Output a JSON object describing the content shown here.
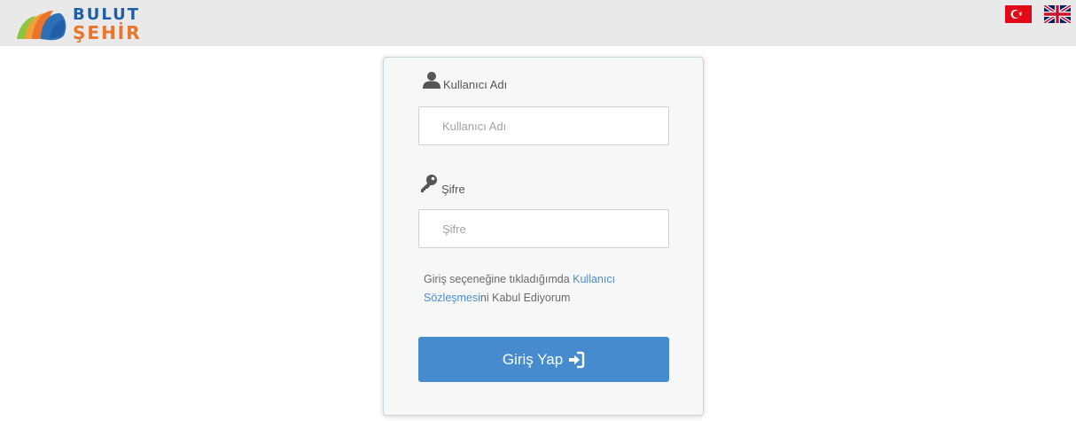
{
  "header": {
    "logo": {
      "line1": "BULUT",
      "line2": "ŞEHİR"
    },
    "languages": [
      {
        "code": "tr",
        "icon": "turkey-flag-icon"
      },
      {
        "code": "en",
        "icon": "uk-flag-icon"
      }
    ]
  },
  "login": {
    "username": {
      "label": "Kullanıcı Adı",
      "placeholder": "Kullanıcı Adı",
      "value": "",
      "icon": "user-icon"
    },
    "password": {
      "label": "Şifre",
      "placeholder": "Şifre",
      "value": "",
      "icon": "key-icon"
    },
    "agreement": {
      "prefix": "Giriş seçeneğine tıkladığımda ",
      "link_text": "Kullanıcı Sözleşmesi",
      "suffix": "ni Kabul Ediyorum"
    },
    "submit_label": "Giriş Yap",
    "submit_icon": "sign-in-icon"
  },
  "colors": {
    "header_bg": "#e9e9e9",
    "brand_blue": "#1f5fa8",
    "brand_orange": "#e9742a",
    "button_blue": "#468bcd",
    "link_blue": "#4a8fd0"
  }
}
